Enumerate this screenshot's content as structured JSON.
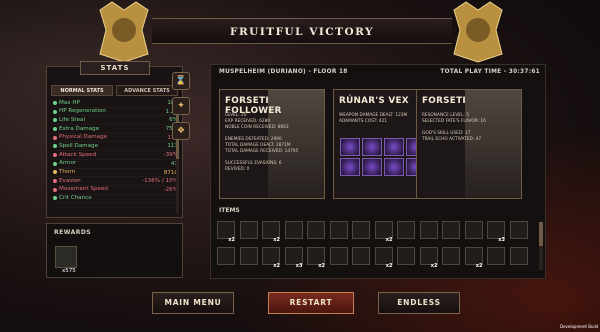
{
  "banner": {
    "title": "FRUITFUL VICTORY"
  },
  "stats": {
    "title": "STATS",
    "tabs": [
      "NORMAL STATS",
      "ADVANCE STATS"
    ],
    "rows": [
      {
        "name": "Max HP",
        "value": "183",
        "color": "#6fd38a"
      },
      {
        "name": "HP Regeneration",
        "value": "1.25",
        "color": "#6fd38a"
      },
      {
        "name": "Life Steal",
        "value": "6%",
        "color": "#6fd38a"
      },
      {
        "name": "Extra Damage",
        "value": "75%",
        "color": "#6fd38a"
      },
      {
        "name": "Physical Damage",
        "value": "113",
        "color": "#e1707a"
      },
      {
        "name": "Spell Damage",
        "value": "113",
        "color": "#6fd38a"
      },
      {
        "name": "Attack Speed",
        "value": "-39%",
        "color": "#e1707a"
      },
      {
        "name": "Armor",
        "value": "41",
        "color": "#6fd38a"
      },
      {
        "name": "Thorn",
        "value": "8710",
        "color": "#e7b65c"
      },
      {
        "name": "Evasion",
        "value": "-136% / 10%",
        "color": "#e1707a"
      },
      {
        "name": "Movement Speed",
        "value": "-26%",
        "color": "#e1707a"
      },
      {
        "name": "Crit Chance",
        "value": "",
        "color": "#6fd38a"
      }
    ]
  },
  "rewards": {
    "title": "REWARDS",
    "count": "x575"
  },
  "run": {
    "area": "MUSPELHEIM (DURIANO) - FLOOR 18",
    "play_time": "TOTAL PLAY TIME - 30:37:61"
  },
  "cards": [
    {
      "title": "FORSETI FOLLOWER",
      "lines": [
        "LEVEL: 20",
        "EXP RECEIVED: 6280",
        "NOBLE COIN RECEIVED: 8663",
        "",
        "ENEMIES DEFEATED: 2990",
        "TOTAL DAMAGE DEALT: 2871M",
        "TOTAL DAMAGE RECEIVED: 14795",
        "",
        "SUCCESSFUL EVASIONS: 6",
        "REVIVED: 0"
      ]
    },
    {
      "title": "RÚNAR'S VEX",
      "lines": [
        "WEAPON DAMAGE DEALT: 123M",
        "ADAMANTS COST: 421"
      ]
    },
    {
      "title": "FORSETI",
      "lines": [
        "RESONANCE LEVEL: 5",
        "SELECTED FATE'S FLAVOR: 16",
        "",
        "GOD'S SKILL USED: 17",
        "TRAIL ECHO ACTIVATED: 47"
      ]
    }
  ],
  "items": {
    "title": "ITEMS",
    "row1": [
      "x2",
      "",
      "x2",
      "",
      "",
      "",
      "",
      "x2",
      "",
      "",
      "",
      "",
      "x3",
      ""
    ],
    "row2": [
      "",
      "",
      "x2",
      "x3",
      "x2",
      "",
      "",
      "x2",
      "",
      "x2",
      "",
      "x2",
      "",
      ""
    ]
  },
  "buttons": {
    "main_menu": "MAIN MENU",
    "restart": "RESTART",
    "endless": "ENDLESS"
  },
  "build": "Development Build"
}
